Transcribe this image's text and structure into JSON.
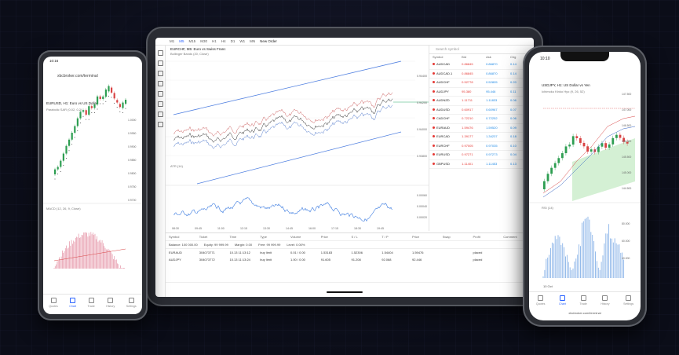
{
  "tablet": {
    "toolbar": {
      "timeframes": [
        "M1",
        "M5",
        "M15",
        "M30",
        "H1",
        "H4",
        "D1",
        "W1",
        "MN"
      ],
      "active_timeframe": "M5",
      "new_order": "New Order"
    },
    "chart_title": "EURCHF, M5: Euro vs Swiss Franc",
    "indicator_label": "Bollinger Bands (20, Close)",
    "atr_label": "ATR (14)",
    "y_ticks_main": [
      "0.94400",
      "0.94200",
      "0.94000",
      "0.93800"
    ],
    "y_ticks_atr": [
      "0.00060",
      "0.00040",
      "0.00020"
    ],
    "time_ticks": [
      "08:30",
      "09:45",
      "11:00",
      "12:15",
      "13:30",
      "14:45",
      "16:00",
      "17:15",
      "18:30",
      "19:45",
      "21:00",
      "22:15"
    ],
    "watchlist": {
      "search_placeholder": "Search symbol",
      "headers": [
        "Symbol",
        "Bid",
        "Ask",
        "Chg"
      ],
      "rows": [
        {
          "symbol": "AUDCAD",
          "bid": "0.86845",
          "ask": "0.86870",
          "chg": "0.14"
        },
        {
          "symbol": "AUDCAD.1",
          "bid": "0.86845",
          "ask": "0.86870",
          "chg": "0.14"
        },
        {
          "symbol": "AUDCHF",
          "bid": "0.52778",
          "ask": "0.52805",
          "chg": "0.20"
        },
        {
          "symbol": "AUDJPY",
          "bid": "95.380",
          "ask": "95.446",
          "chg": "0.11"
        },
        {
          "symbol": "AUDNZD",
          "bid": "1.11711",
          "ask": "1.11833",
          "chg": "0.06"
        },
        {
          "symbol": "AUDUSD",
          "bid": "0.60917",
          "ask": "0.60967",
          "chg": "0.07"
        },
        {
          "symbol": "CADCHF",
          "bid": "0.72210",
          "ask": "0.72252",
          "chg": "0.06"
        },
        {
          "symbol": "EURAUD",
          "bid": "1.59476",
          "ask": "1.59520",
          "chg": "0.09"
        },
        {
          "symbol": "EURCAD",
          "bid": "1.39177",
          "ask": "1.34237",
          "chg": "0.18"
        },
        {
          "symbol": "EURCHF",
          "bid": "0.97005",
          "ask": "0.97035",
          "chg": "0.10"
        },
        {
          "symbol": "EURUSD",
          "bid": "0.97271",
          "ask": "0.97273",
          "chg": "0.04"
        },
        {
          "symbol": "GBPUSD",
          "bid": "1.11401",
          "ask": "1.11453",
          "chg": "0.13"
        }
      ]
    },
    "balance": {
      "balance": "Balance: 100 000.00",
      "equity": "Equity: 99 999.99",
      "margin": "Margin: 0.00",
      "free": "Free: 99 999.99",
      "level": "Level: 0.00%"
    },
    "orders": {
      "headers": [
        "Symbol",
        "Ticket",
        "Time",
        "Type",
        "Volume",
        "Price",
        "S / L",
        "T / P",
        "Price",
        "Swap",
        "Profit",
        "Comment"
      ],
      "rows": [
        [
          "EURAUD",
          "304073771",
          "10.13 11:13:12",
          "buy limit",
          "0.01 / 0.00",
          "1.53183",
          "1.52306",
          "1.54404",
          "1.59476",
          "",
          "placed",
          ""
        ],
        [
          "AUDJPY",
          "304073772",
          "10.13 11:13:24",
          "buy limit",
          "1.00 / 0.00",
          "91.605",
          "91.208",
          "92.068",
          "92.446",
          "",
          "placed",
          ""
        ]
      ]
    }
  },
  "phone_left": {
    "status_time": "10:16",
    "url": "xbcbroker.com/terminal",
    "chart_title": "EURUSD, H1: Euro vs US Dollar",
    "indicator_label": "Parabolic SAR (0.02, 0.2)",
    "macd_label": "MACD (12, 26, 9, Close)",
    "y_ticks": [
      "1.0000",
      "0.9950",
      "0.9900",
      "0.9850",
      "0.9800",
      "0.9750",
      "0.9700"
    ],
    "nav": [
      "Quotes",
      "Chart",
      "Trade",
      "History",
      "Settings"
    ],
    "active_nav": "Chart"
  },
  "phone_right": {
    "status_time": "10:10",
    "chart_title": "USDJPY, H1: US Dollar vs Yen",
    "indicator_label": "Ichimoku Kinko Hyo (9, 26, 52)",
    "rsi_label": "RSI (14)",
    "y_ticks": [
      "147.500",
      "147.000",
      "146.500",
      "146.000",
      "145.500",
      "145.000",
      "144.500"
    ],
    "rsi_ticks": [
      "80.000",
      "60.000",
      "40.000"
    ],
    "date_label": "10 Oct",
    "nav": [
      "Quotes",
      "Chart",
      "Trade",
      "History",
      "Settings"
    ],
    "active_nav": "Chart",
    "url": "xbcbroker.com/terminal"
  },
  "colors": {
    "bull": "#2e9e52",
    "bear": "#d84343",
    "band": "#4f7fe0",
    "accent": "#2962ff"
  }
}
